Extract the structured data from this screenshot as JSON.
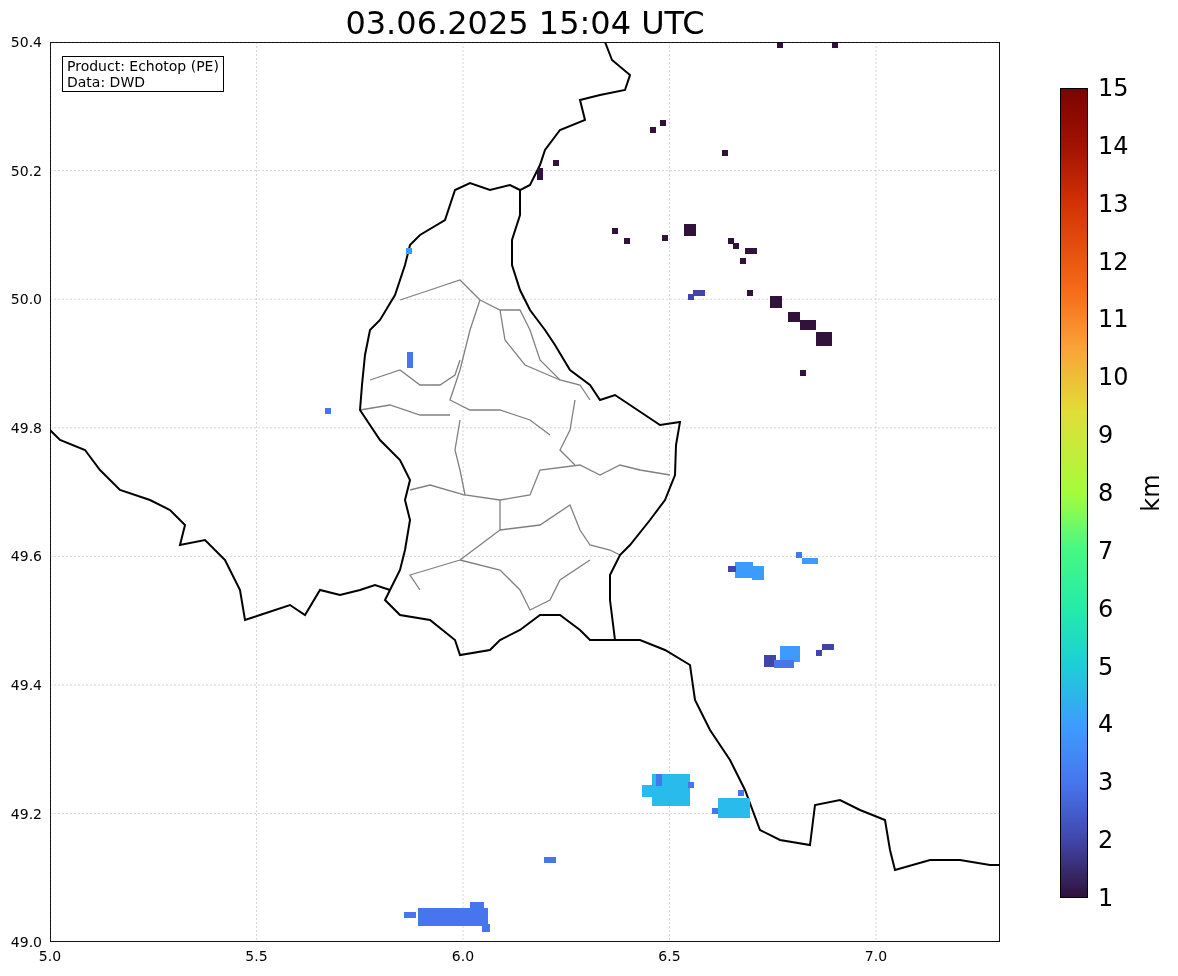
{
  "title": "03.06.2025 15:04 UTC",
  "info_box": {
    "lines": [
      "Product: Echotop (PE)",
      "Data: DWD"
    ]
  },
  "map": {
    "xticks": [
      "5.0",
      "5.5",
      "6.0",
      "6.5",
      "7.0"
    ],
    "yticks": [
      "50.4",
      "50.2",
      "50.0",
      "49.8",
      "49.6",
      "49.4",
      "49.2",
      "49.0"
    ]
  },
  "colorbar": {
    "label": "km",
    "ticks": [
      "15",
      "14",
      "13",
      "12",
      "11",
      "10",
      "9",
      "8",
      "7",
      "6",
      "5",
      "4",
      "3",
      "2",
      "1"
    ]
  }
}
